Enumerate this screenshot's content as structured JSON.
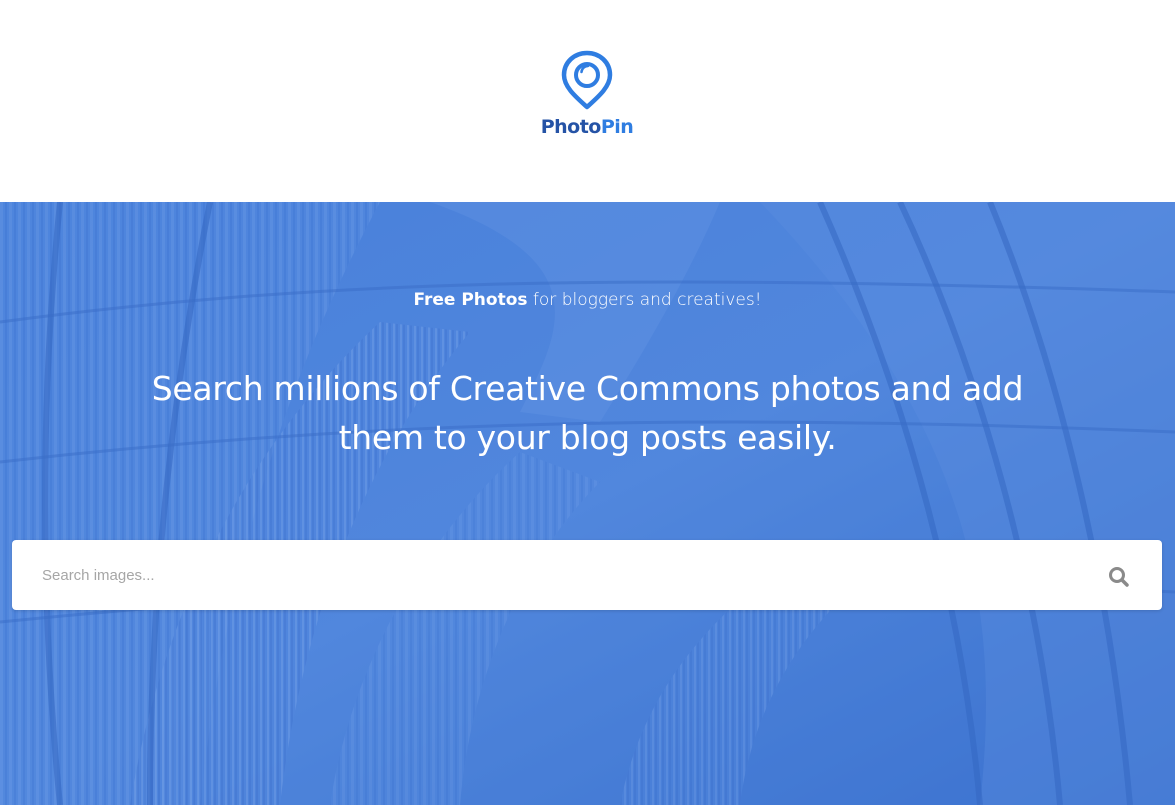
{
  "header": {
    "logo": {
      "word_part1": "Photo",
      "word_part2": "Pin",
      "icon": "map-pin-camera-icon"
    }
  },
  "hero": {
    "tagline_bold": "Free Photos",
    "tagline_rest": " for bloggers and creatives!",
    "headline": "Search millions of Creative Commons photos and add them to your blog posts easily.",
    "background": "library-bookshelves-photo-blue-overlay"
  },
  "search": {
    "placeholder": "Search images...",
    "value": "",
    "button_icon": "search-icon"
  },
  "colors": {
    "brand_dark": "#2553a6",
    "brand_light": "#2f7de1",
    "hero_overlay": "#3f78d6",
    "white": "#ffffff"
  }
}
